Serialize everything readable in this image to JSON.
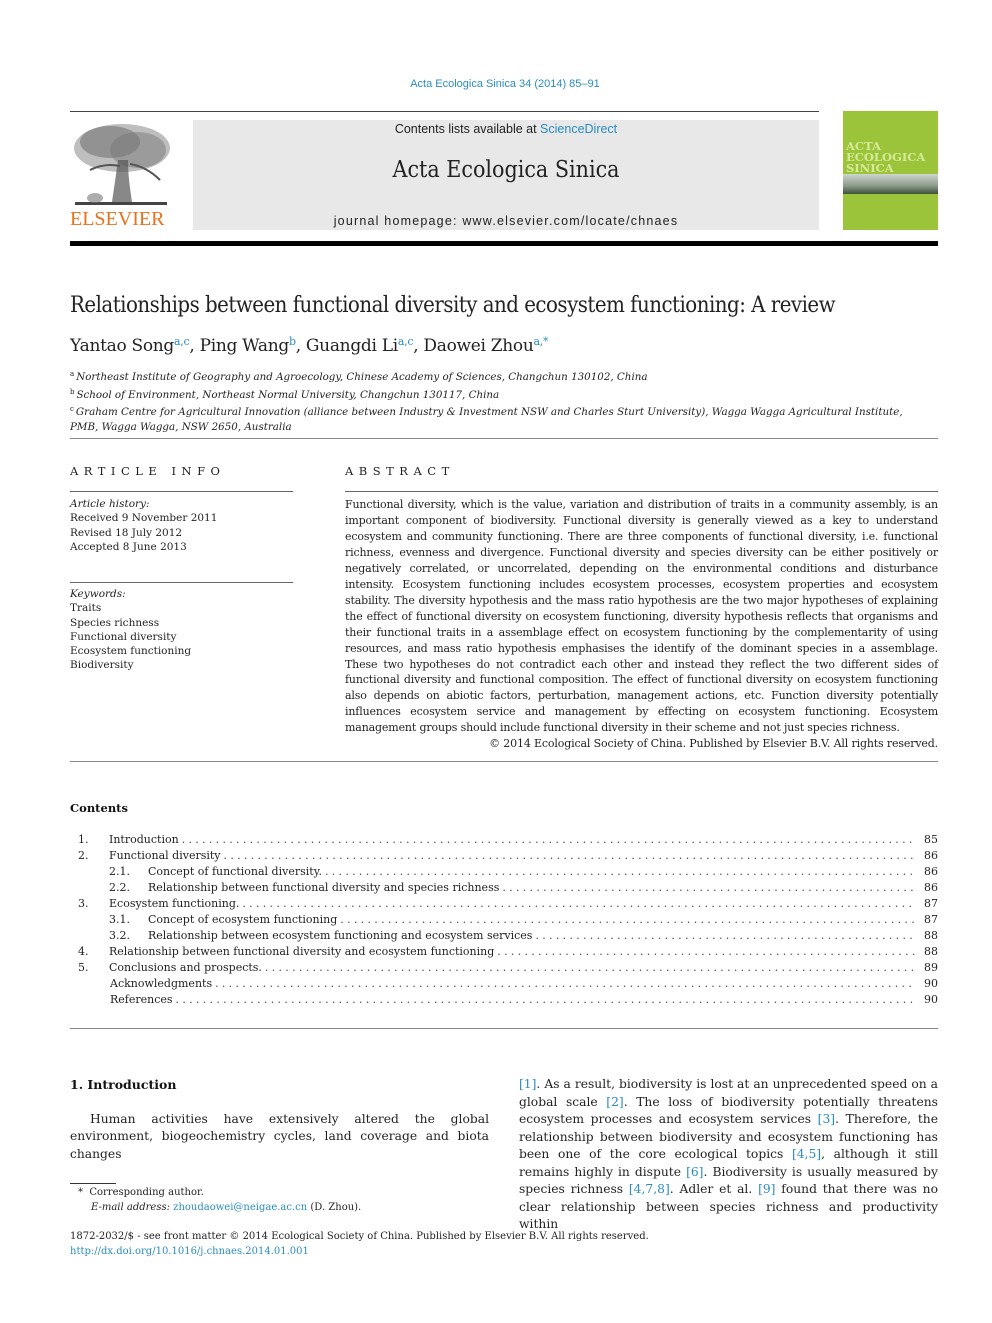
{
  "header": {
    "citation": "Acta Ecologica Sinica 34 (2014) 85–91",
    "contents_prefix": "Contents lists available at ",
    "contents_link": "ScienceDirect",
    "journal_title": "Acta Ecologica Sinica",
    "homepage": "journal homepage: www.elsevier.com/locate/chnaes",
    "publisher_logo_text": "ELSEVIER",
    "cover_title": [
      "ACTA",
      "ECOLOGICA",
      "SINICA"
    ],
    "colors": {
      "link": "#2a8cc0",
      "elsevier_orange": "#e9711c",
      "cover_green": "#9cc43a",
      "banner_gray": "#e8e8e8"
    }
  },
  "article": {
    "title": "Relationships between functional diversity and ecosystem functioning: A review",
    "authors": [
      {
        "name": "Yantao Song",
        "sup": "a,c",
        "sep": ", "
      },
      {
        "name": "Ping Wang",
        "sup": "b",
        "sep": ", "
      },
      {
        "name": "Guangdi Li",
        "sup": "a,c",
        "sep": ", "
      },
      {
        "name": "Daowei Zhou",
        "sup": "a,*",
        "sep": ""
      }
    ],
    "affiliations": [
      {
        "mark": "a",
        "text": "Northeast Institute of Geography and Agroecology, Chinese Academy of Sciences, Changchun 130102, China"
      },
      {
        "mark": "b",
        "text": "School of Environment, Northeast Normal University, Changchun 130117, China"
      },
      {
        "mark": "c",
        "text": "Graham Centre for Agricultural Innovation (alliance between Industry & Investment NSW and Charles Sturt University), Wagga Wagga Agricultural Institute,"
      },
      {
        "mark": "",
        "text": "PMB, Wagga Wagga, NSW 2650, Australia"
      }
    ]
  },
  "article_info": {
    "heading": "ARTICLE INFO",
    "history_label": "Article history:",
    "history": [
      "Received 9 November 2011",
      "Revised 18 July 2012",
      "Accepted 8 June 2013"
    ],
    "keywords_label": "Keywords:",
    "keywords": [
      "Traits",
      "Species richness",
      "Functional diversity",
      "Ecosystem functioning",
      "Biodiversity"
    ]
  },
  "abstract": {
    "heading": "ABSTRACT",
    "body": "Functional diversity, which is the value, variation and distribution of traits in a community assembly, is an important component of biodiversity. Functional diversity is generally viewed as a key to understand ecosystem and community functioning. There are three components of functional diversity, i.e. functional richness, evenness and divergence. Functional diversity and species diversity can be either positively or negatively correlated, or uncorrelated, depending on the environmental conditions and disturbance intensity. Ecosystem functioning includes ecosystem processes, ecosystem properties and ecosystem stability. The diversity hypothesis and the mass ratio hypothesis are the two major hypotheses of explaining the effect of functional diversity on ecosystem functioning, diversity hypothesis reflects that organisms and their functional traits in a assemblage effect on ecosystem functioning by the complementarity of using resources, and mass ratio hypothesis emphasises the identify of the dominant species in a assemblage. These two hypotheses do not contradict each other and instead they reflect the two different sides of functional diversity and functional composition. The effect of functional diversity on ecosystem functioning also depends on abiotic factors, perturbation, management actions, etc. Function diversity potentially influences ecosystem service and management by effecting on ecosystem functioning. Ecosystem management groups should include functional diversity in their scheme and not just species richness.",
    "copyright": "© 2014 Ecological Society of China. Published by Elsevier B.V. All rights reserved."
  },
  "contents": {
    "heading": "Contents",
    "items": [
      {
        "num": "1.",
        "label": "Introduction",
        "page": "85",
        "level": 1
      },
      {
        "num": "2.",
        "label": "Functional diversity",
        "page": "86",
        "level": 1
      },
      {
        "num": "2.1.",
        "label": "Concept of functional diversity.",
        "page": "86",
        "level": 2
      },
      {
        "num": "2.2.",
        "label": "Relationship between functional diversity and species richness",
        "page": "86",
        "level": 2
      },
      {
        "num": "3.",
        "label": "Ecosystem functioning.",
        "page": "87",
        "level": 1
      },
      {
        "num": "3.1.",
        "label": "Concept of ecosystem functioning",
        "page": "87",
        "level": 2
      },
      {
        "num": "3.2.",
        "label": "Relationship between ecosystem functioning and ecosystem services",
        "page": "88",
        "level": 2
      },
      {
        "num": "4.",
        "label": "Relationship between functional diversity and ecosystem functioning",
        "page": "88",
        "level": 1
      },
      {
        "num": "5.",
        "label": "Conclusions and prospects.",
        "page": "89",
        "level": 1
      },
      {
        "num": "",
        "label": "Acknowledgments",
        "page": "90",
        "level": 0
      },
      {
        "num": "",
        "label": "References",
        "page": "90",
        "level": 0
      }
    ]
  },
  "introduction": {
    "heading": "1. Introduction",
    "left_text": "Human activities have extensively altered the global environment, biogeochemistry cycles, land coverage and biota changes",
    "right_segments": [
      {
        "t": "[1]",
        "ref": true
      },
      {
        "t": ". As a result, biodiversity is lost at an unprecedented speed on a global scale ",
        "ref": false
      },
      {
        "t": "[2]",
        "ref": true
      },
      {
        "t": ". The loss of biodiversity potentially threatens ecosystem processes and ecosystem services ",
        "ref": false
      },
      {
        "t": "[3]",
        "ref": true
      },
      {
        "t": ". Therefore, the relationship between biodiversity and ecosystem functioning has been one of the core ecological topics ",
        "ref": false
      },
      {
        "t": "[4,5]",
        "ref": true
      },
      {
        "t": ", although it still remains highly in dispute ",
        "ref": false
      },
      {
        "t": "[6]",
        "ref": true
      },
      {
        "t": ". Biodiversity is usually measured by species richness ",
        "ref": false
      },
      {
        "t": "[4,7,8]",
        "ref": true
      },
      {
        "t": ". Adler et al. ",
        "ref": false
      },
      {
        "t": "[9]",
        "ref": true
      },
      {
        "t": " found that there was no clear relationship between species richness and productivity within",
        "ref": false
      }
    ]
  },
  "footnote": {
    "mark": "*",
    "corresponding": "Corresponding author.",
    "email_label": "E-mail address:",
    "email": "zhoudaowei@neigae.ac.cn",
    "email_suffix": " (D. Zhou)."
  },
  "front_matter": {
    "issn_line": "1872-2032/$ - see front matter © 2014 Ecological Society of China. Published by Elsevier B.V. All rights reserved.",
    "doi": "http://dx.doi.org/10.1016/j.chnaes.2014.01.001"
  }
}
